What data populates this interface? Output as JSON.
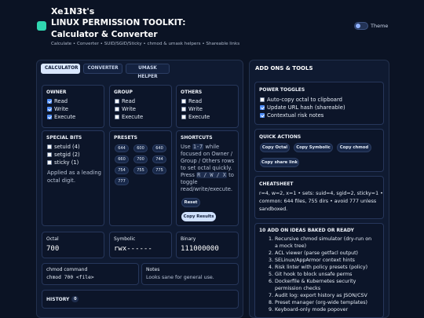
{
  "header": {
    "brand": "Xe1N3t's",
    "title_line1": "LINUX PERMISSION TOOLKIT:",
    "title_line2": "Calculator & Converter",
    "subtitle": "Calculate • Converter • SUID/SGID/Sticky • chmod & umask helpers • Shareable links",
    "theme_label": "Theme"
  },
  "tabs": [
    {
      "label": "CALCULATOR",
      "active": true
    },
    {
      "label": "CONVERTER",
      "active": false
    },
    {
      "label": "UMASK HELPER",
      "active": false
    }
  ],
  "perm_groups": [
    {
      "title": "OWNER",
      "items": [
        {
          "label": "Read",
          "checked": true
        },
        {
          "label": "Write",
          "checked": true
        },
        {
          "label": "Execute",
          "checked": true
        }
      ]
    },
    {
      "title": "GROUP",
      "items": [
        {
          "label": "Read",
          "checked": false
        },
        {
          "label": "Write",
          "checked": false
        },
        {
          "label": "Execute",
          "checked": false
        }
      ]
    },
    {
      "title": "OTHERS",
      "items": [
        {
          "label": "Read",
          "checked": false
        },
        {
          "label": "Write",
          "checked": false
        },
        {
          "label": "Execute",
          "checked": false
        }
      ]
    }
  ],
  "special_bits": {
    "title": "SPECIAL BITS",
    "items": [
      {
        "label": "setuid (4)",
        "checked": false
      },
      {
        "label": "setgid (2)",
        "checked": false
      },
      {
        "label": "sticky (1)",
        "checked": false
      }
    ],
    "note_line1": "Applied as a leading",
    "note_line2": "octal digit."
  },
  "presets": {
    "title": "PRESETS",
    "values": [
      "644",
      "600",
      "640",
      "660",
      "700",
      "744",
      "754",
      "755",
      "775",
      "777"
    ]
  },
  "shortcuts": {
    "title": "SHORTCUTS",
    "line1_pre": "Use",
    "key_range": "1-7",
    "line1_post": "while",
    "line2": "focused on Owner /",
    "line3": "Group / Others rows",
    "line4": "to set octal quickly.",
    "line5_pre": "Press",
    "key_rwx": "R / W / X",
    "line5_post": "to",
    "line6": "toggle",
    "line7": "read/write/execute.",
    "reset_label": "Reset",
    "copy_label": "Copy Results"
  },
  "results": {
    "octal_label": "Octal",
    "octal_value": "700",
    "symbolic_label": "Symbolic",
    "symbolic_value": "rwx------",
    "binary_label": "Binary",
    "binary_value": "111000000"
  },
  "chmod_cmd": {
    "label": "chmod command",
    "value": "chmod 700 <file>"
  },
  "notes": {
    "label": "Notes",
    "value": "Looks sane for general use."
  },
  "history": {
    "label": "HISTORY",
    "count": "0"
  },
  "right": {
    "title": "ADD ONS & TOOLS",
    "power_toggles": {
      "title": "POWER TOGGLES",
      "items": [
        {
          "label": "Auto-copy octal to clipboard",
          "checked": false
        },
        {
          "label": "Update URL hash (shareable)",
          "checked": true
        },
        {
          "label": "Contextual risk notes",
          "checked": true
        }
      ]
    },
    "quick_actions": {
      "title": "QUICK ACTIONS",
      "buttons": [
        "Copy Octal",
        "Copy Symbolic",
        "Copy chmod",
        "Copy share link"
      ]
    },
    "cheatsheet": {
      "title": "CHEATSHEET",
      "line1": "r=4, w=2, x=1 • sets: suid=4, sgid=2, sticky=1 •",
      "line2": "common: 644 files, 755 dirs • avoid 777 unless",
      "line3": "sandboxed."
    },
    "ideas": {
      "title": "10 ADD ON IDEAS BAKED OR READY",
      "items": [
        "1. Recursive chmod simulator (dry-run on",
        "a mock tree)",
        "2. ACL viewer (parse getfacl output)",
        "3. SELinux/AppArmor context hints",
        "4. Risk linter with policy presets (policy)",
        "5. Git hook to block unsafe perms",
        "6. Dockerfile & Kubernetes security",
        "permission checks",
        "7. Audit log: export history as JSON/CSV",
        "8. Preset manager (org-wide templates)",
        "9. Keyboard-only mode popover"
      ]
    }
  }
}
